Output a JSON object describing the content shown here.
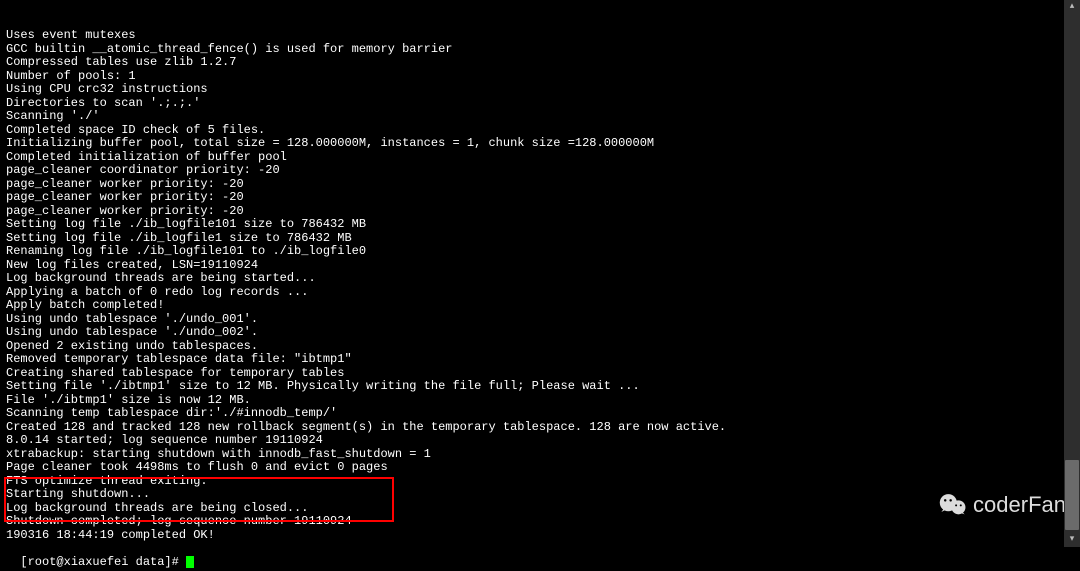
{
  "terminal": {
    "lines": [
      "Uses event mutexes",
      "GCC builtin __atomic_thread_fence() is used for memory barrier",
      "Compressed tables use zlib 1.2.7",
      "Number of pools: 1",
      "Using CPU crc32 instructions",
      "Directories to scan '.;.;.'",
      "Scanning './'",
      "Completed space ID check of 5 files.",
      "Initializing buffer pool, total size = 128.000000M, instances = 1, chunk size =128.000000M",
      "Completed initialization of buffer pool",
      "page_cleaner coordinator priority: -20",
      "page_cleaner worker priority: -20",
      "page_cleaner worker priority: -20",
      "page_cleaner worker priority: -20",
      "Setting log file ./ib_logfile101 size to 786432 MB",
      "Setting log file ./ib_logfile1 size to 786432 MB",
      "Renaming log file ./ib_logfile101 to ./ib_logfile0",
      "New log files created, LSN=19110924",
      "Log background threads are being started...",
      "Applying a batch of 0 redo log records ...",
      "Apply batch completed!",
      "Using undo tablespace './undo_001'.",
      "Using undo tablespace './undo_002'.",
      "Opened 2 existing undo tablespaces.",
      "Removed temporary tablespace data file: \"ibtmp1\"",
      "Creating shared tablespace for temporary tables",
      "Setting file './ibtmp1' size to 12 MB. Physically writing the file full; Please wait ...",
      "File './ibtmp1' size is now 12 MB.",
      "Scanning temp tablespace dir:'./#innodb_temp/'",
      "Created 128 and tracked 128 new rollback segment(s) in the temporary tablespace. 128 are now active.",
      "8.0.14 started; log sequence number 19110924",
      "xtrabackup: starting shutdown with innodb_fast_shutdown = 1",
      "Page cleaner took 4498ms to flush 0 and evict 0 pages",
      "FTS optimize thread exiting.",
      "Starting shutdown...",
      "Log background threads are being closed...",
      "Shutdown completed; log sequence number 19110924",
      "190316 18:44:19 completed OK!"
    ],
    "prompt": "[root@xiaxuefei data]# "
  },
  "watermark": {
    "text": "coderFan"
  }
}
